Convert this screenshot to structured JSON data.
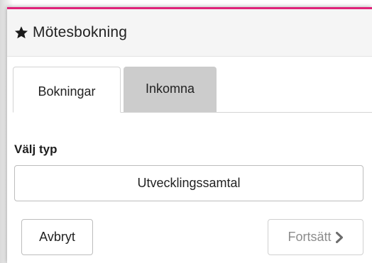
{
  "header": {
    "icon": "star-icon",
    "title": "Mötesbokning"
  },
  "tabs": [
    {
      "label": "Bokningar",
      "active": true
    },
    {
      "label": "Inkomna",
      "active": false
    }
  ],
  "form": {
    "section_label": "Välj typ",
    "type_option": "Utvecklingssamtal"
  },
  "actions": {
    "cancel_label": "Avbryt",
    "continue_label": "Fortsätt",
    "continue_icon": "chevron-right-icon",
    "continue_enabled": false
  },
  "colors": {
    "accent": "#e0237a",
    "inactive_tab": "#cccccc",
    "header_bg": "#f5f5f5"
  }
}
